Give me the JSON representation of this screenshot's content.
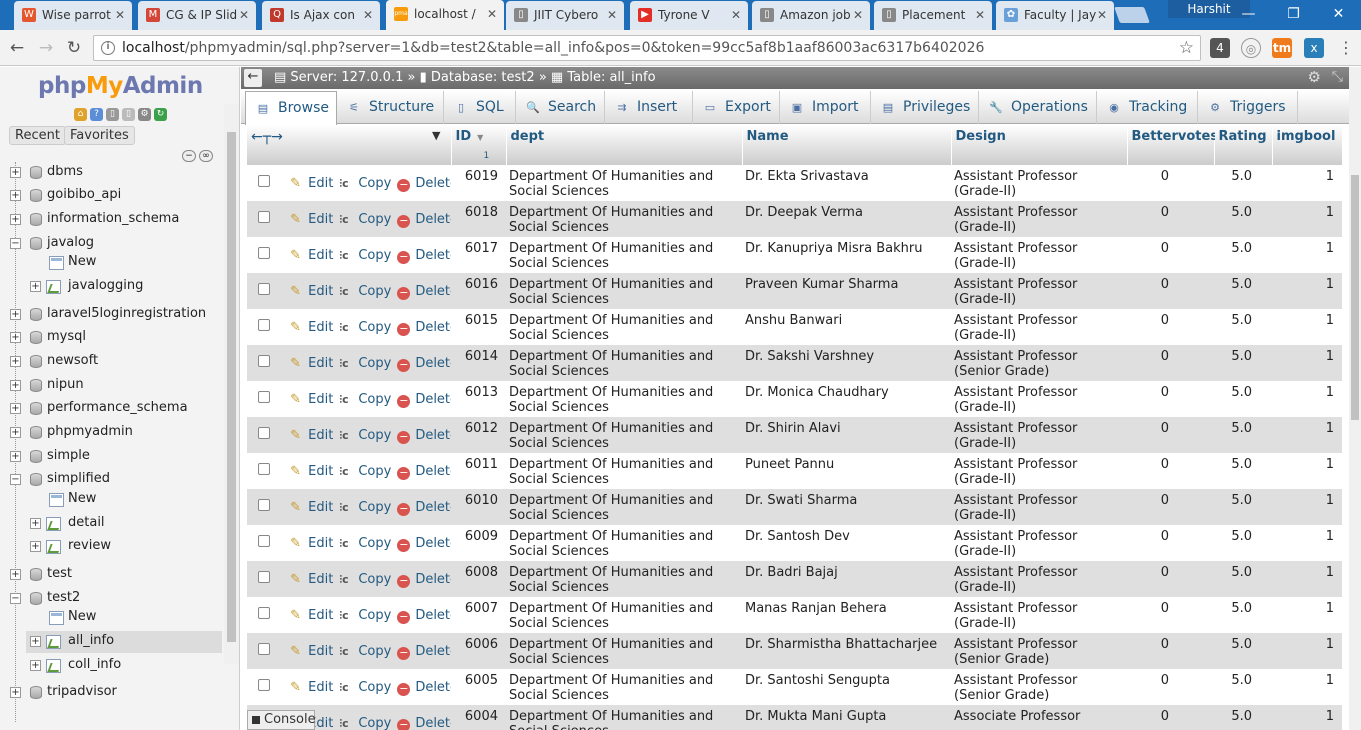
{
  "browser": {
    "tabs": [
      {
        "label": "Wise parrot",
        "icon_color": "#e4572e",
        "icon": "W"
      },
      {
        "label": "CG & IP Slid",
        "icon_color": "#d44638",
        "icon": "M"
      },
      {
        "label": "Is Ajax con",
        "icon_color": "#c0392b",
        "icon": "Q"
      },
      {
        "label": "localhost /",
        "icon_color": "#f89c0e",
        "icon": "pma"
      },
      {
        "label": "JIIT Cybero",
        "icon_color": "#888888",
        "icon": "▯"
      },
      {
        "label": "Tyrone V",
        "icon_color": "#e52d27",
        "icon": "▶"
      },
      {
        "label": "Amazon job",
        "icon_color": "#888888",
        "icon": "▯"
      },
      {
        "label": "Placement",
        "icon_color": "#888888",
        "icon": "▯"
      },
      {
        "label": "Faculty | Jay",
        "icon_color": "#6aa0d8",
        "icon": "✿"
      }
    ],
    "profile_name": "Harshit",
    "url_host": "localhost",
    "url_path": "/phpmyadmin/sql.php?server=1&db=test2&table=all_info&pos=0&token=99cc5af8b1aaf86003ac6317b6402026",
    "ext_badges": {
      "first": "4",
      "last": "x"
    }
  },
  "sidebar": {
    "logo": {
      "php": "php",
      "my": "My",
      "admin": "Admin"
    },
    "tabs": {
      "recent": "Recent",
      "favorites": "Favorites"
    },
    "tree": [
      {
        "label": "dbms",
        "type": "db",
        "exp": "+"
      },
      {
        "label": "goibibo_api",
        "type": "db",
        "exp": "+"
      },
      {
        "label": "information_schema",
        "type": "db",
        "exp": "+"
      },
      {
        "label": "javalog",
        "type": "db",
        "exp": "−"
      },
      {
        "label": "New",
        "type": "new"
      },
      {
        "label": "javalogging",
        "type": "table",
        "exp": "+"
      },
      {
        "label": "laravel5loginregistration",
        "type": "db",
        "exp": "+"
      },
      {
        "label": "mysql",
        "type": "db",
        "exp": "+"
      },
      {
        "label": "newsoft",
        "type": "db",
        "exp": "+"
      },
      {
        "label": "nipun",
        "type": "db",
        "exp": "+"
      },
      {
        "label": "performance_schema",
        "type": "db",
        "exp": "+"
      },
      {
        "label": "phpmyadmin",
        "type": "db",
        "exp": "+"
      },
      {
        "label": "simple",
        "type": "db",
        "exp": "+"
      },
      {
        "label": "simplified",
        "type": "db",
        "exp": "−"
      },
      {
        "label": "New",
        "type": "new"
      },
      {
        "label": "detail",
        "type": "table",
        "exp": "+"
      },
      {
        "label": "review",
        "type": "table",
        "exp": "+"
      },
      {
        "label": "test",
        "type": "db",
        "exp": "+"
      },
      {
        "label": "test2",
        "type": "db",
        "exp": "−"
      },
      {
        "label": "New",
        "type": "new"
      },
      {
        "label": "all_info",
        "type": "table",
        "exp": "+",
        "selected": true
      },
      {
        "label": "coll_info",
        "type": "table",
        "exp": "+"
      },
      {
        "label": "tripadvisor",
        "type": "db",
        "exp": "+"
      }
    ]
  },
  "breadcrumb": {
    "server": "Server: 127.0.0.1",
    "database": "Database: test2",
    "table": "Table: all_info"
  },
  "tabs": [
    {
      "label": "Browse",
      "icon": "▤"
    },
    {
      "label": "Structure",
      "icon": "⚟"
    },
    {
      "label": "SQL",
      "icon": "▯"
    },
    {
      "label": "Search",
      "icon": "🔍"
    },
    {
      "label": "Insert",
      "icon": "⇉"
    },
    {
      "label": "Export",
      "icon": "▭"
    },
    {
      "label": "Import",
      "icon": "▣"
    },
    {
      "label": "Privileges",
      "icon": "▤"
    },
    {
      "label": "Operations",
      "icon": "🔧"
    },
    {
      "label": "Tracking",
      "icon": "◉"
    },
    {
      "label": "Triggers",
      "icon": "⚙"
    }
  ],
  "table": {
    "columns": [
      "ID",
      "dept",
      "Name",
      "Design",
      "Bettervotes",
      "Rating",
      "imgbool"
    ],
    "sort_index": "1",
    "actions": {
      "edit": "Edit",
      "copy": "Copy",
      "delete": "Delete"
    },
    "rows": [
      {
        "id": "6019",
        "dept": "Department Of Humanities and Social Sciences",
        "name": "Dr. Ekta Srivastava",
        "design": "Assistant Professor (Grade-II)",
        "votes": "0",
        "rating": "5.0",
        "img": "1"
      },
      {
        "id": "6018",
        "dept": "Department Of Humanities and Social Sciences",
        "name": "Dr. Deepak Verma",
        "design": "Assistant Professor (Grade-II)",
        "votes": "0",
        "rating": "5.0",
        "img": "1"
      },
      {
        "id": "6017",
        "dept": "Department Of Humanities and Social Sciences",
        "name": "Dr. Kanupriya Misra Bakhru",
        "design": "Assistant  Professor (Grade-II)",
        "votes": "0",
        "rating": "5.0",
        "img": "1"
      },
      {
        "id": "6016",
        "dept": "Department Of Humanities and Social Sciences",
        "name": "Praveen Kumar Sharma",
        "design": "Assistant  Professor (Grade-II)",
        "votes": "0",
        "rating": "5.0",
        "img": "1"
      },
      {
        "id": "6015",
        "dept": "Department Of Humanities and Social Sciences",
        "name": "Anshu Banwari",
        "design": "Assistant Professor (Grade-II)",
        "votes": "0",
        "rating": "5.0",
        "img": "1"
      },
      {
        "id": "6014",
        "dept": "Department Of Humanities and Social Sciences",
        "name": "Dr. Sakshi Varshney",
        "design": "Assistant Professor (Senior Grade)",
        "votes": "0",
        "rating": "5.0",
        "img": "1"
      },
      {
        "id": "6013",
        "dept": "Department Of Humanities and Social Sciences",
        "name": "Dr. Monica Chaudhary",
        "design": "Assistant  Professor (Grade-II)",
        "votes": "0",
        "rating": "5.0",
        "img": "1"
      },
      {
        "id": "6012",
        "dept": "Department Of Humanities and Social Sciences",
        "name": "Dr. Shirin Alavi",
        "design": "Assistant  Professor (Grade-II)",
        "votes": "0",
        "rating": "5.0",
        "img": "1"
      },
      {
        "id": "6011",
        "dept": "Department Of Humanities and Social Sciences",
        "name": "Puneet Pannu",
        "design": "Assistant  Professor (Grade-II)",
        "votes": "0",
        "rating": "5.0",
        "img": "1"
      },
      {
        "id": "6010",
        "dept": "Department Of Humanities and Social Sciences",
        "name": "Dr. Swati Sharma",
        "design": "Assistant  Professor (Grade-II)",
        "votes": "0",
        "rating": "5.0",
        "img": "1"
      },
      {
        "id": "6009",
        "dept": "Department Of Humanities and Social Sciences",
        "name": "Dr. Santosh Dev",
        "design": "Assistant  Professor (Grade-II)",
        "votes": "0",
        "rating": "5.0",
        "img": "1"
      },
      {
        "id": "6008",
        "dept": "Department Of Humanities and Social Sciences",
        "name": "Dr. Badri Bajaj",
        "design": "Assistant  Professor (Grade-II)",
        "votes": "0",
        "rating": "5.0",
        "img": "1"
      },
      {
        "id": "6007",
        "dept": "Department Of Humanities and Social Sciences",
        "name": "Manas Ranjan Behera",
        "design": "Assistant  Professor (Grade-II)",
        "votes": "0",
        "rating": "5.0",
        "img": "1"
      },
      {
        "id": "6006",
        "dept": "Department Of Humanities and Social Sciences",
        "name": "Dr. Sharmistha Bhattacharjee",
        "design": "Assistant Professor (Senior Grade)",
        "votes": "0",
        "rating": "5.0",
        "img": "1"
      },
      {
        "id": "6005",
        "dept": "Department Of Humanities and Social Sciences",
        "name": "Dr. Santoshi Sengupta",
        "design": "Assistant Professor (Senior Grade)",
        "votes": "0",
        "rating": "5.0",
        "img": "1"
      },
      {
        "id": "6004",
        "dept": "Department Of Humanities and Social Sciences",
        "name": "Dr. Mukta Mani Gupta",
        "design": "Associate Professor",
        "votes": "0",
        "rating": "5.0",
        "img": "1"
      }
    ]
  },
  "console_label": "Console"
}
